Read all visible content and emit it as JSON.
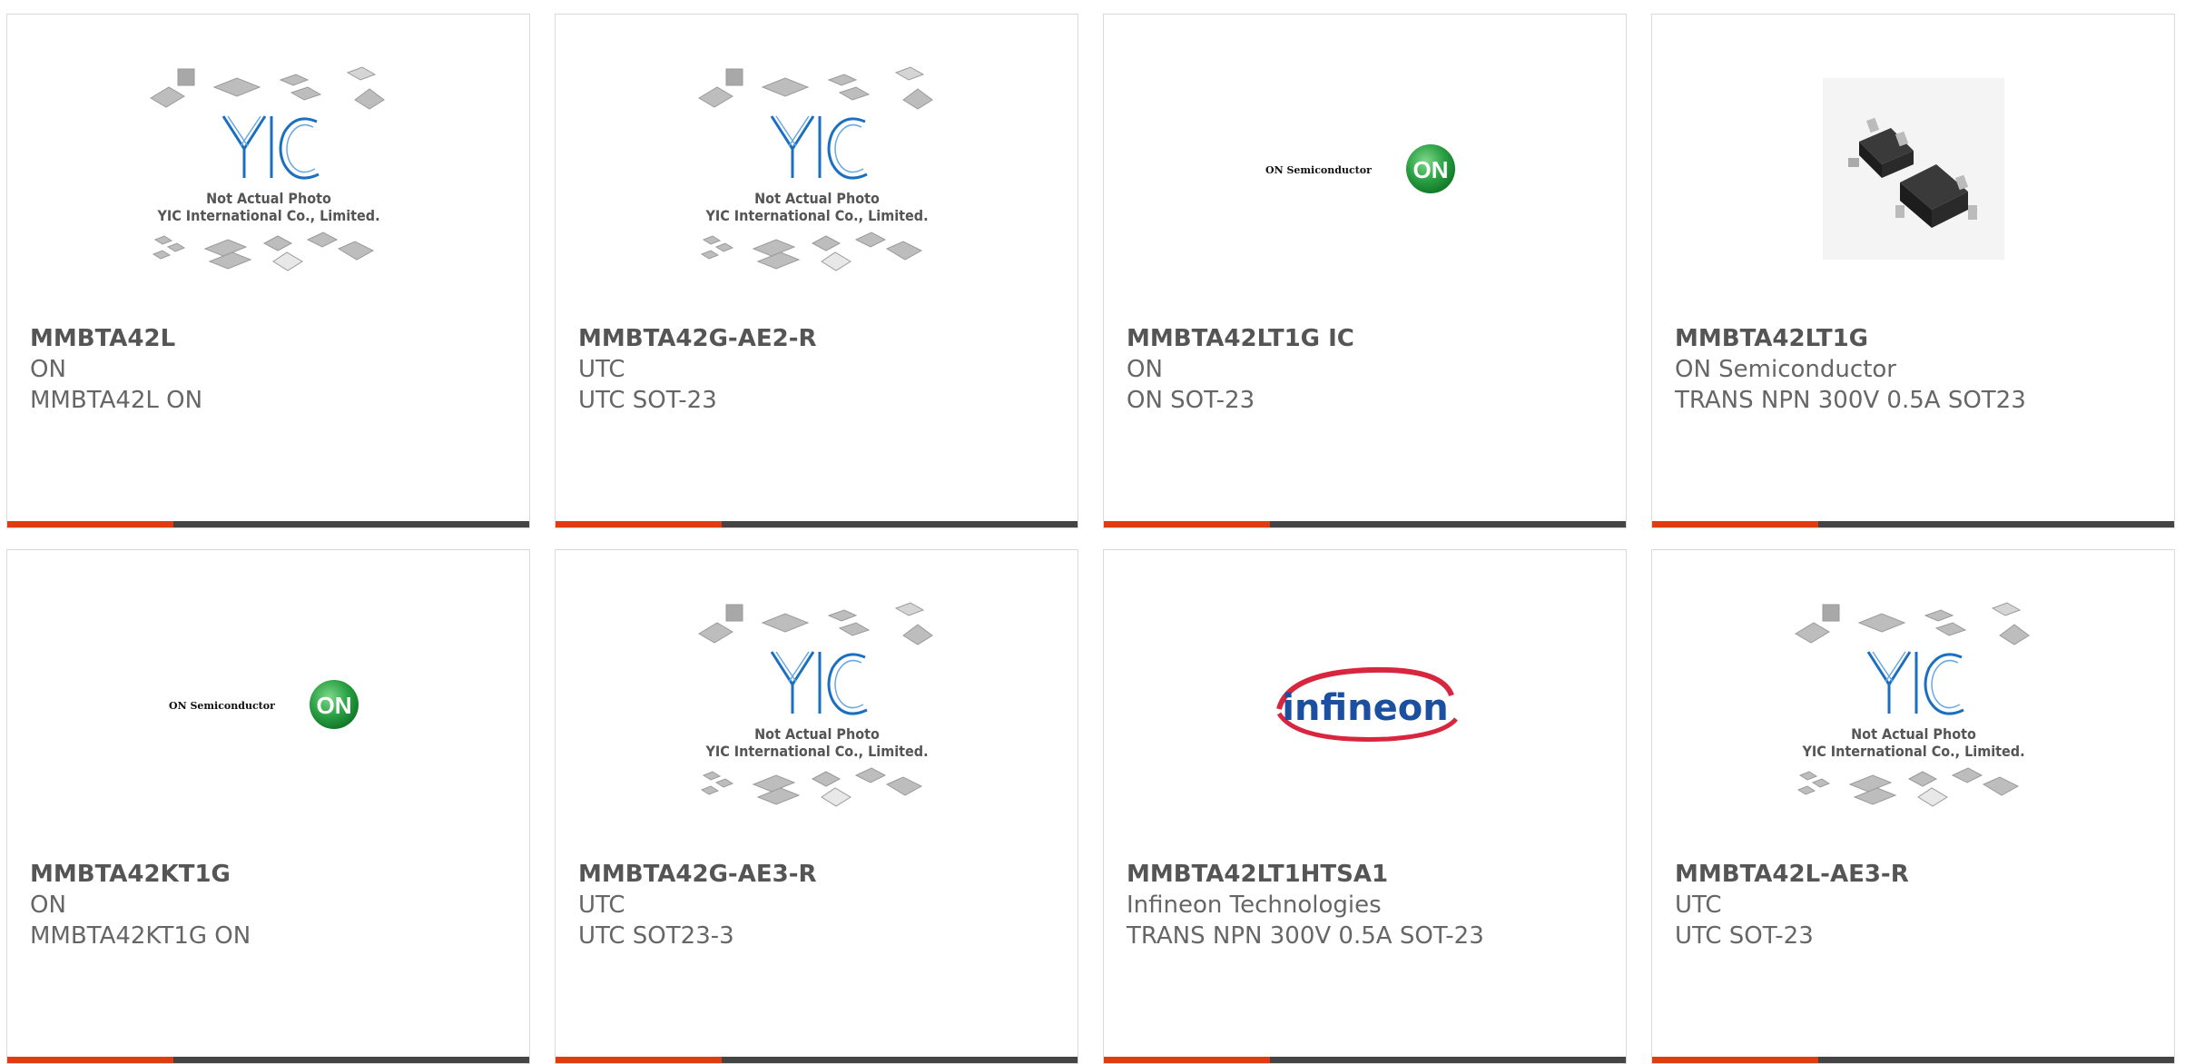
{
  "placeholder": {
    "line1": "Not Actual Photo",
    "line2": "YIC International Co., Limited.",
    "logo_text": "YIC"
  },
  "onsemi_logo": {
    "text": "ON Semiconductor",
    "badge": "ON"
  },
  "infineon_logo": {
    "text": "infineon"
  },
  "colors": {
    "accent": "#e03c10",
    "bar": "#444444",
    "border": "#d9d9d9",
    "yic_blue": "#1a6fc0",
    "on_green": "#2aa043",
    "infineon_blue": "#1b4fa0",
    "infineon_red": "#d8263f"
  },
  "products": [
    {
      "part": "MMBTA42L",
      "manufacturer": "ON",
      "description": "MMBTA42L ON",
      "image": "yic-placeholder"
    },
    {
      "part": "MMBTA42G-AE2-R",
      "manufacturer": "UTC",
      "description": "UTC SOT-23",
      "image": "yic-placeholder"
    },
    {
      "part": "MMBTA42LT1G IC",
      "manufacturer": "ON",
      "description": "ON SOT-23",
      "image": "onsemi-logo"
    },
    {
      "part": "MMBTA42LT1G",
      "manufacturer": "ON Semiconductor",
      "description": "TRANS NPN 300V 0.5A SOT23",
      "image": "sot23-photo"
    },
    {
      "part": "MMBTA42KT1G",
      "manufacturer": "ON",
      "description": "MMBTA42KT1G ON",
      "image": "onsemi-logo"
    },
    {
      "part": "MMBTA42G-AE3-R",
      "manufacturer": "UTC",
      "description": "UTC SOT23-3",
      "image": "yic-placeholder"
    },
    {
      "part": "MMBTA42LT1HTSA1",
      "manufacturer": "Infineon Technologies",
      "description": "TRANS NPN 300V 0.5A SOT-23",
      "image": "infineon-logo"
    },
    {
      "part": "MMBTA42L-AE3-R",
      "manufacturer": "UTC",
      "description": "UTC SOT-23",
      "image": "yic-placeholder"
    }
  ]
}
